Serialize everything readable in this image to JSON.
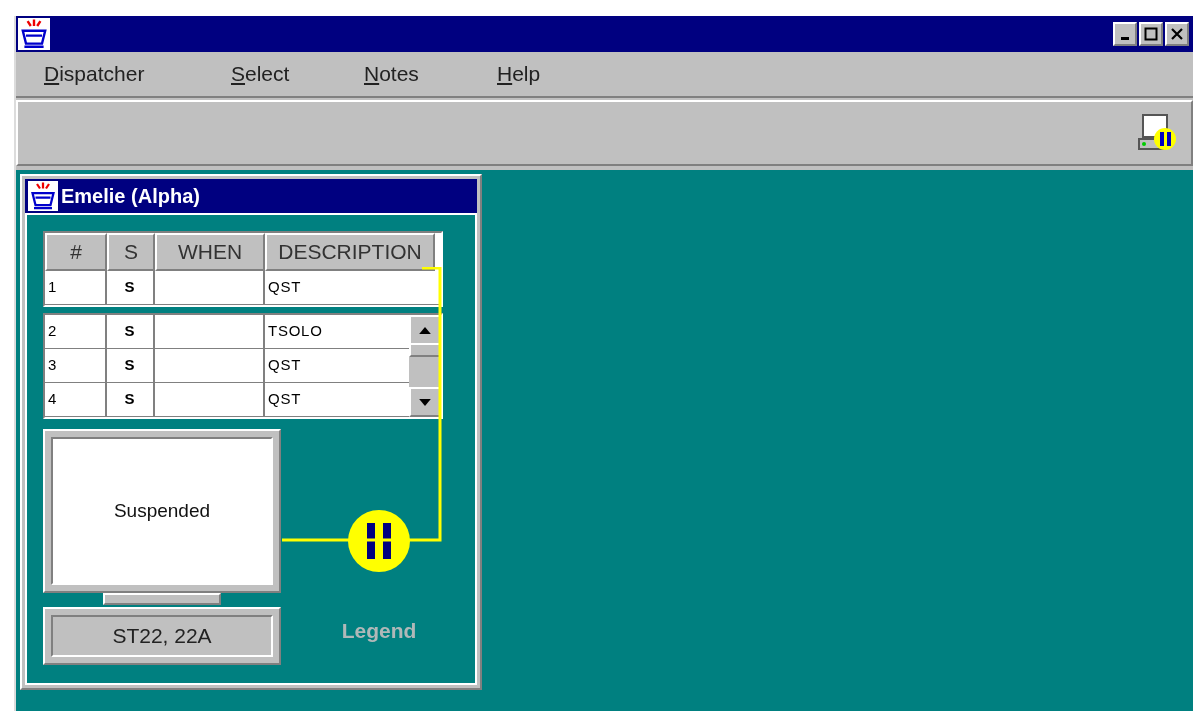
{
  "menu": [
    {
      "label": "Dispatcher"
    },
    {
      "label": "Select"
    },
    {
      "label": "Notes"
    },
    {
      "label": "Help"
    }
  ],
  "frame": {
    "title": "Emelie (Alpha)",
    "table": {
      "columns": [
        "#",
        "S",
        "WHEN",
        "DESCRIPTION"
      ],
      "pinned_rows": [
        [
          "1",
          "S",
          "",
          "QST"
        ]
      ],
      "rows": [
        [
          "2",
          "S",
          "",
          "TSOLO"
        ],
        [
          "3",
          "S",
          "",
          "QST"
        ],
        [
          "4",
          "S",
          "",
          "QST"
        ]
      ]
    },
    "terminal": {
      "status": "Suspended",
      "label": "ST22, 22A"
    },
    "legend": "Legend"
  }
}
